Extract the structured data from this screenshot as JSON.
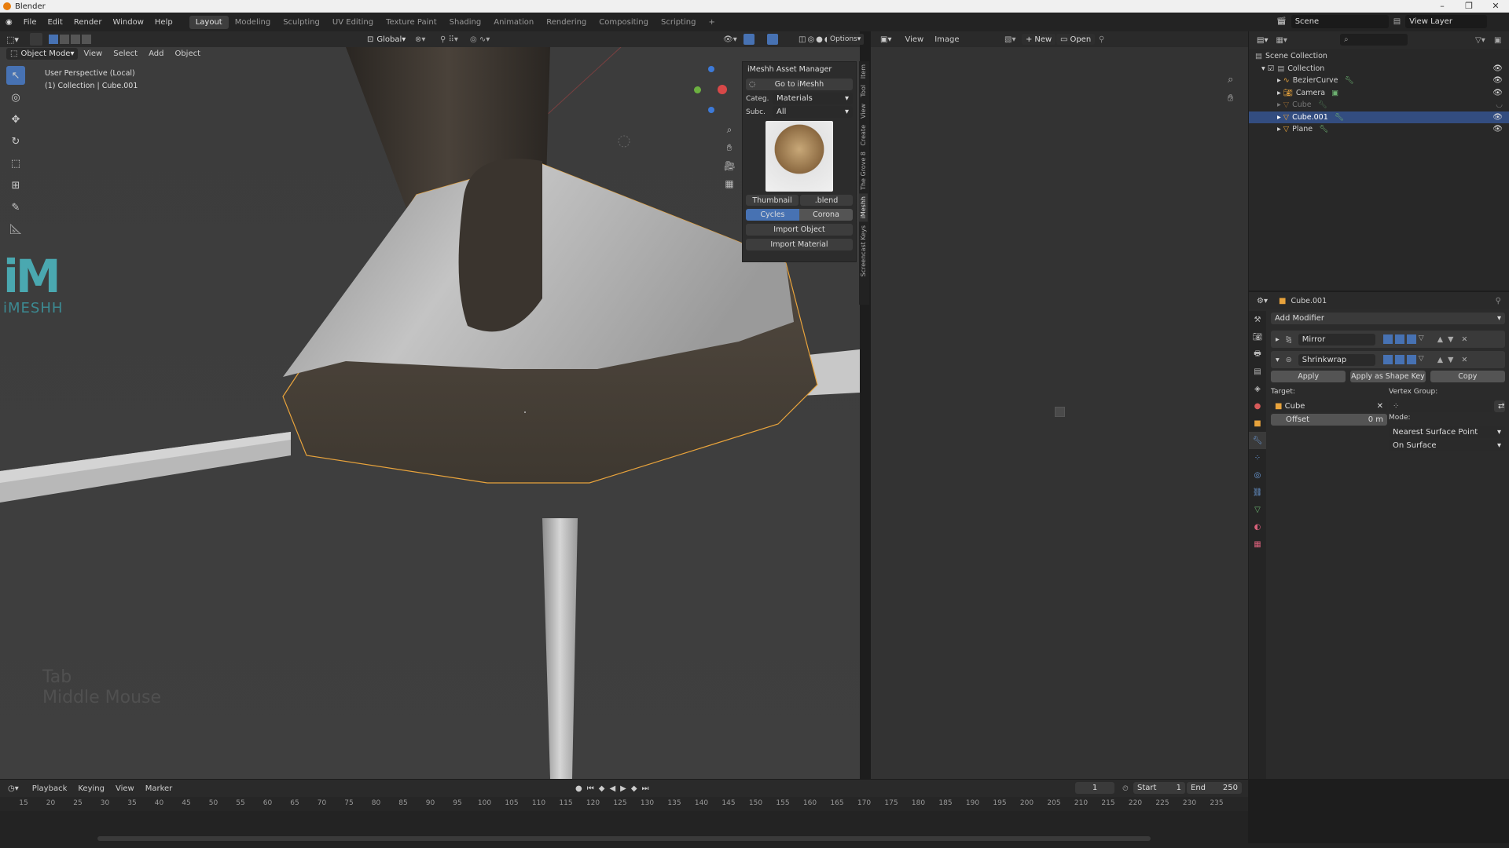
{
  "window": {
    "title": "Blender",
    "controls": [
      "–",
      "❐",
      "✕"
    ]
  },
  "menu": [
    "File",
    "Edit",
    "Render",
    "Window",
    "Help"
  ],
  "workspaces": [
    "Layout",
    "Modeling",
    "Sculpting",
    "UV Editing",
    "Texture Paint",
    "Shading",
    "Animation",
    "Rendering",
    "Compositing",
    "Scripting",
    "+"
  ],
  "scene": {
    "label": "Scene",
    "view_layer": "View Layer"
  },
  "viewport": {
    "transform_orientation": "Global",
    "options_label": "Options",
    "mode": "Object Mode",
    "menus": [
      "View",
      "Select",
      "Add",
      "Object"
    ],
    "overlay_line1": "User Perspective (Local)",
    "overlay_line2": "(1) Collection | Cube.001",
    "logo_text": "iMESHH",
    "key_hint_1": "Tab",
    "key_hint_2": "Middle Mouse"
  },
  "imeshh_panel": {
    "title": "iMeshh Asset Manager",
    "go_button": "Go to iMeshh",
    "category_label": "Categ.",
    "category_value": "Materials",
    "subcategory_label": "Subc.",
    "subcategory_value": "All",
    "thumbnail_label": "Thumbnail",
    "blend_label": ".blend",
    "engine_cycles": "Cycles",
    "engine_corona": "Corona",
    "import_object": "Import Object",
    "import_material": "Import Material"
  },
  "n_tabs": [
    "Item",
    "Tool",
    "View",
    "Create",
    "The Grove 8",
    "iMeshh",
    "Screencast Keys"
  ],
  "image_editor": {
    "menus": [
      "View",
      "Image"
    ],
    "new_label": "New",
    "open_label": "Open"
  },
  "outliner": {
    "rows": [
      {
        "name": "Scene Collection",
        "indent": 0,
        "sel": false
      },
      {
        "name": "Collection",
        "indent": 1,
        "sel": false
      },
      {
        "name": "BezierCurve",
        "indent": 2,
        "sel": false
      },
      {
        "name": "Camera",
        "indent": 2,
        "sel": false
      },
      {
        "name": "Cube",
        "indent": 2,
        "sel": false
      },
      {
        "name": "Cube.001",
        "indent": 2,
        "sel": true
      },
      {
        "name": "Plane",
        "indent": 2,
        "sel": false
      }
    ]
  },
  "properties": {
    "object_name": "Cube.001",
    "add_modifier": "Add Modifier",
    "modifiers": [
      "Mirror",
      "Shrinkwrap"
    ],
    "apply": "Apply",
    "apply_shape": "Apply as Shape Key",
    "copy": "Copy",
    "target_label": "Target:",
    "target_value": "Cube",
    "vertex_group_label": "Vertex Group:",
    "offset_label": "Offset",
    "offset_value": "0 m",
    "mode_label": "Mode:",
    "mode_value": "Nearest Surface Point",
    "snap_value": "On Surface"
  },
  "timeline": {
    "menus": [
      "Playback",
      "Keying",
      "View",
      "Marker"
    ],
    "current_frame": "1",
    "start_label": "Start",
    "start_value": "1",
    "end_label": "End",
    "end_value": "250",
    "ticks": [
      "15",
      "20",
      "25",
      "30",
      "35",
      "40",
      "45",
      "50",
      "55",
      "60",
      "65",
      "70",
      "75",
      "80",
      "85",
      "90",
      "95",
      "100",
      "105",
      "110",
      "115",
      "120",
      "125",
      "130",
      "135",
      "140",
      "145",
      "150",
      "155",
      "160",
      "165",
      "170",
      "175",
      "180",
      "185",
      "190",
      "195",
      "200",
      "205",
      "210",
      "215",
      "220",
      "225",
      "230",
      "235"
    ]
  },
  "colors": {
    "accent": "#4772b3",
    "select_outline": "#e8a33c",
    "selected_row": "#334d80"
  }
}
